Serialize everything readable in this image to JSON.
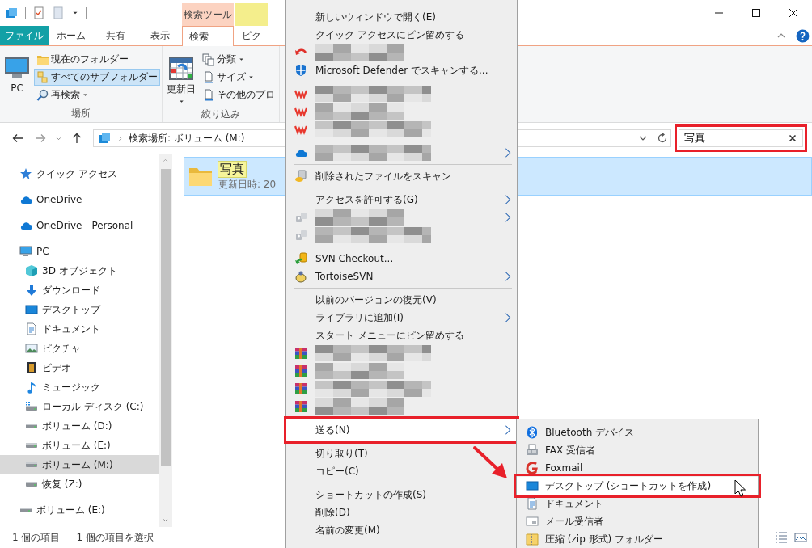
{
  "ribbon": {
    "tabs": [
      {
        "label": "ファイル",
        "kind": "file",
        "selected": false
      },
      {
        "label": "ホーム",
        "kind": "main",
        "selected": false
      },
      {
        "label": "共有",
        "kind": "main",
        "selected": false
      },
      {
        "label": "表示",
        "kind": "main",
        "selected": false
      }
    ],
    "context_groups": [
      {
        "header": "検索ツール",
        "color": "#fcd3c1",
        "tabs": [
          {
            "label": "検索",
            "selected": true
          }
        ]
      },
      {
        "color": "#f4ee8c",
        "tabs": [
          {
            "label": "ピク",
            "selected": false
          }
        ]
      }
    ],
    "groups": [
      {
        "label": "場所",
        "commands": [
          {
            "label": "PC",
            "kind": "large",
            "dropdown": false,
            "selected": false
          },
          {
            "label": "現在のフォルダー",
            "kind": "small",
            "dropdown": false,
            "selected": false
          },
          {
            "label": "すべてのサブフォルダー",
            "kind": "small",
            "dropdown": false,
            "selected": true
          },
          {
            "label": "再検索",
            "kind": "small",
            "dropdown": true,
            "selected": false
          }
        ]
      },
      {
        "label": "絞り込み",
        "commands": [
          {
            "label": "更新日",
            "kind": "large",
            "dropdown": true,
            "selected": false
          },
          {
            "label": "分類",
            "kind": "small",
            "dropdown": true,
            "selected": false
          },
          {
            "label": "サイズ",
            "kind": "small",
            "dropdown": true,
            "selected": false
          },
          {
            "label": "その他のプロ",
            "kind": "small",
            "dropdown": false,
            "selected": false
          }
        ]
      }
    ]
  },
  "address_bar": {
    "path": "検索場所: ボリューム (M:)"
  },
  "search": {
    "value": "写真",
    "annotated": true
  },
  "navigation": [
    {
      "label": "クイック アクセス",
      "selected": false
    },
    {
      "label": "OneDrive",
      "selected": false
    },
    {
      "label": "OneDrive - Personal",
      "selected": false
    },
    {
      "label": "PC",
      "selected": false,
      "children": [
        {
          "label": "3D オブジェクト",
          "selected": false
        },
        {
          "label": "ダウンロード",
          "selected": false
        },
        {
          "label": "デスクトップ",
          "selected": false
        },
        {
          "label": "ドキュメント",
          "selected": false
        },
        {
          "label": "ピクチャ",
          "selected": false
        },
        {
          "label": "ビデオ",
          "selected": false
        },
        {
          "label": "ミュージック",
          "selected": false
        },
        {
          "label": "ローカル ディスク (C:)",
          "selected": false
        },
        {
          "label": "ボリューム (D:)",
          "selected": false
        },
        {
          "label": "ボリューム (E:)",
          "selected": false
        },
        {
          "label": "ボリューム (M:)",
          "selected": true
        },
        {
          "label": "恢复 (Z:)",
          "selected": false
        }
      ]
    },
    {
      "label": "ボリューム (E:)",
      "selected": false
    }
  ],
  "results": [
    {
      "name": "写真",
      "modified": "更新日時: 20",
      "selected": true,
      "matched": true
    }
  ],
  "status_bar": [
    "1 個の項目",
    "1 個の項目を選択"
  ],
  "context_menu": {
    "items": [
      {
        "kind": "command",
        "label": "新しいウィンドウで開く(E)",
        "submenu": false,
        "selected": false,
        "annotated": false
      },
      {
        "kind": "command",
        "label": "クイック アクセスにピン留めする",
        "submenu": false,
        "selected": false,
        "annotated": false
      },
      {
        "kind": "redacted",
        "submenu": false,
        "selected": false,
        "annotated": false
      },
      {
        "kind": "command",
        "label": "Microsoft Defender でスキャンする...",
        "submenu": false,
        "selected": false,
        "annotated": false
      },
      {
        "kind": "separator"
      },
      {
        "kind": "redacted",
        "submenu": false,
        "selected": false,
        "annotated": false
      },
      {
        "kind": "redacted",
        "submenu": false,
        "selected": false,
        "annotated": false
      },
      {
        "kind": "redacted",
        "submenu": false,
        "selected": false,
        "annotated": false
      },
      {
        "kind": "separator"
      },
      {
        "kind": "redacted",
        "submenu": true,
        "selected": false,
        "annotated": false
      },
      {
        "kind": "separator"
      },
      {
        "kind": "command",
        "label": "削除されたファイルをスキャン",
        "submenu": false,
        "selected": false,
        "annotated": false
      },
      {
        "kind": "separator"
      },
      {
        "kind": "command",
        "label": "アクセスを許可する(G)",
        "submenu": true,
        "selected": false,
        "annotated": false
      },
      {
        "kind": "redacted",
        "submenu": true,
        "selected": false,
        "annotated": false
      },
      {
        "kind": "redacted",
        "submenu": false,
        "selected": false,
        "annotated": false
      },
      {
        "kind": "separator"
      },
      {
        "kind": "command",
        "label": "SVN Checkout...",
        "submenu": false,
        "selected": false,
        "annotated": false
      },
      {
        "kind": "command",
        "label": "TortoiseSVN",
        "submenu": true,
        "selected": false,
        "annotated": false
      },
      {
        "kind": "separator"
      },
      {
        "kind": "command",
        "label": "以前のバージョンの復元(V)",
        "submenu": false,
        "selected": false,
        "annotated": false
      },
      {
        "kind": "command",
        "label": "ライブラリに追加(I)",
        "submenu": true,
        "selected": false,
        "annotated": false
      },
      {
        "kind": "command",
        "label": "スタート メニューにピン留めする",
        "submenu": false,
        "selected": false,
        "annotated": false
      },
      {
        "kind": "redacted",
        "submenu": false,
        "selected": false,
        "annotated": false
      },
      {
        "kind": "redacted",
        "submenu": false,
        "selected": false,
        "annotated": false
      },
      {
        "kind": "redacted",
        "submenu": false,
        "selected": false,
        "annotated": false
      },
      {
        "kind": "redacted",
        "submenu": false,
        "selected": false,
        "annotated": false
      },
      {
        "kind": "command",
        "label": "送る(N)",
        "submenu": true,
        "selected": true,
        "annotated": true
      },
      {
        "kind": "command",
        "label": "切り取り(T)",
        "submenu": false,
        "selected": false,
        "annotated": false
      },
      {
        "kind": "command",
        "label": "コピー(C)",
        "submenu": false,
        "selected": false,
        "annotated": false
      },
      {
        "kind": "separator"
      },
      {
        "kind": "command",
        "label": "ショートカットの作成(S)",
        "submenu": false,
        "selected": false,
        "annotated": false
      },
      {
        "kind": "command",
        "label": "削除(D)",
        "submenu": false,
        "selected": false,
        "annotated": false
      },
      {
        "kind": "command",
        "label": "名前の変更(M)",
        "submenu": false,
        "selected": false,
        "annotated": false
      },
      {
        "kind": "separator"
      }
    ]
  },
  "send_to_menu": {
    "items": [
      {
        "label": "Bluetooth デバイス",
        "selected": false,
        "annotated": false
      },
      {
        "label": "FAX 受信者",
        "selected": false,
        "annotated": false
      },
      {
        "label": "Foxmail",
        "selected": false,
        "annotated": false
      },
      {
        "label": "デスクトップ (ショートカットを作成)",
        "selected": true,
        "annotated": true
      },
      {
        "label": "ドキュメント",
        "selected": false,
        "annotated": false
      },
      {
        "label": "メール受信者",
        "selected": false,
        "annotated": false
      },
      {
        "label": "圧縮 (zip 形式) フォルダー",
        "selected": false,
        "annotated": false
      }
    ]
  }
}
